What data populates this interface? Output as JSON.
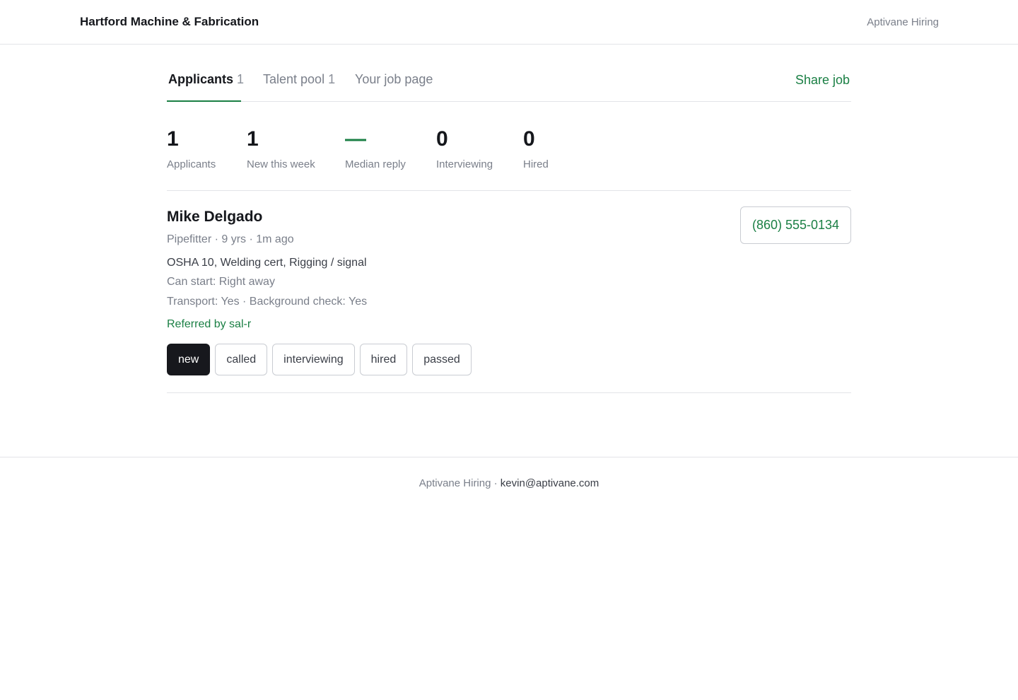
{
  "header": {
    "company_name": "Hartford Machine & Fabrication",
    "brand_link": "Aptivane Hiring"
  },
  "tabs": [
    {
      "label": "Applicants",
      "count": "1",
      "active": true
    },
    {
      "label": "Talent pool",
      "count": "1",
      "active": false
    },
    {
      "label": "Your job page",
      "count": "",
      "active": false
    }
  ],
  "share_job_label": "Share job",
  "stats": [
    {
      "value": "1",
      "label": "Applicants"
    },
    {
      "value": "1",
      "label": "New this week"
    },
    {
      "value": "—",
      "label": "Median reply"
    },
    {
      "value": "0",
      "label": "Interviewing"
    },
    {
      "value": "0",
      "label": "Hired"
    }
  ],
  "applicant": {
    "name": "Mike Delgado",
    "meta": "Pipefitter · 9 yrs · 1m ago",
    "skills": "OSHA 10, Welding cert, Rigging / signal",
    "start": "Can start: Right away",
    "checks": "Transport: Yes · Background check: Yes",
    "referral": "Referred by sal-r",
    "phone": "(860) 555-0134",
    "statuses": [
      "new",
      "called",
      "interviewing",
      "hired",
      "passed"
    ],
    "current_status": "new"
  },
  "footer": {
    "brand": "Aptivane Hiring",
    "separator": "·",
    "email": "kevin@aptivane.com"
  },
  "colors": {
    "accent": "#1a7f44",
    "active_status_bg": "#17181d",
    "border": "#e3e4e8",
    "muted_text": "#7a7f8a"
  }
}
